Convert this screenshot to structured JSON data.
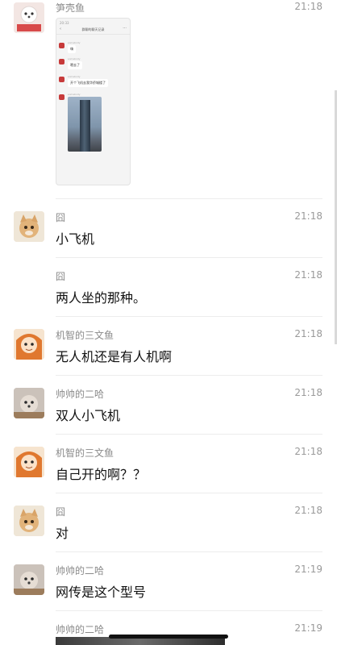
{
  "messages": [
    {
      "name": "笋壳鱼",
      "time": "21:18",
      "type": "image",
      "preview": {
        "status": "20:33",
        "title": "群聊的聊天记录",
        "items": [
          {
            "sender": "somebody",
            "text": "嗨"
          },
          {
            "sender": "somebody",
            "text": "嗯去了"
          },
          {
            "sender": "somebody",
            "text": "开个飞机去我华侨城楼了"
          },
          {
            "sender": "somebody",
            "text": ""
          }
        ]
      }
    },
    {
      "name": "囧",
      "time": "21:18",
      "text": "小飞机"
    },
    {
      "name": "囧",
      "time": "21:18",
      "text": "两人坐的那种。"
    },
    {
      "name": "机智的三文鱼",
      "time": "21:18",
      "text": "无人机还是有人机啊"
    },
    {
      "name": "帅帅的二哈",
      "time": "21:18",
      "text": "双人小飞机"
    },
    {
      "name": "机智的三文鱼",
      "time": "21:18",
      "text": "自己开的啊？？"
    },
    {
      "name": "囧",
      "time": "21:18",
      "text": "对"
    },
    {
      "name": "帅帅的二哈",
      "time": "21:19",
      "text": "网传是这个型号"
    },
    {
      "name": "帅帅的二哈",
      "time": "21:19",
      "text": ""
    }
  ]
}
